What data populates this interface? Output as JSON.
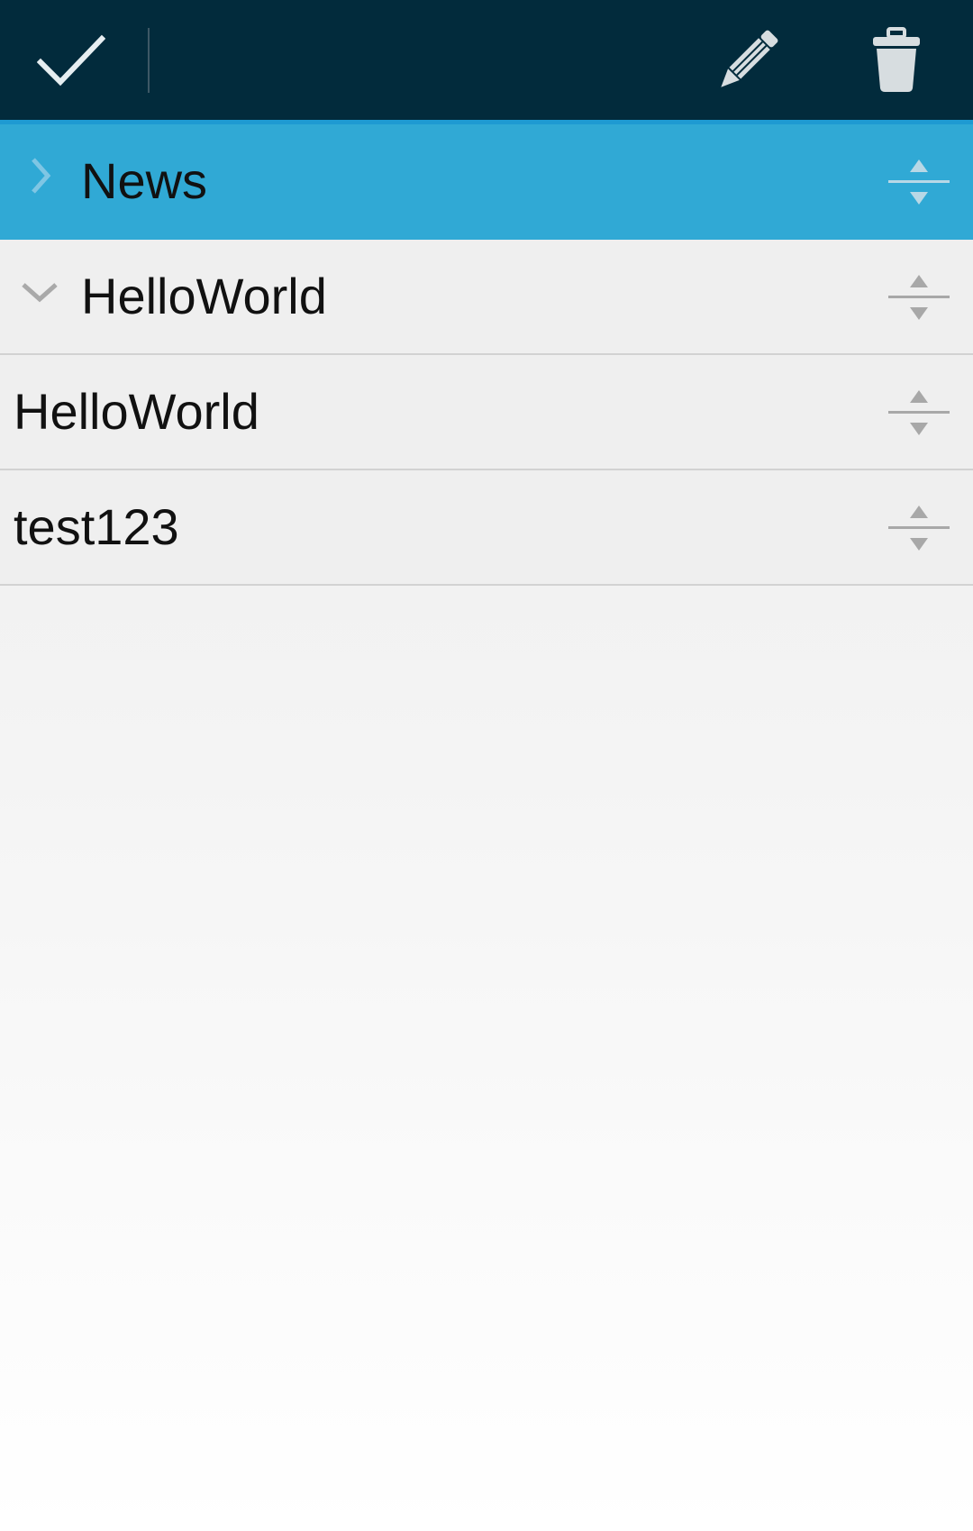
{
  "action_bar": {
    "background": "#022b3c",
    "done_icon": "checkmark-icon",
    "edit_icon": "pencil-icon",
    "delete_icon": "trash-icon"
  },
  "colors": {
    "accent": "#1e9ad2",
    "selected_row": "#30a9d5",
    "row_background": "#efefef"
  },
  "list": {
    "items": [
      {
        "label": "News",
        "expander": "chevron-right-icon",
        "selected": true
      },
      {
        "label": "HelloWorld",
        "expander": "chevron-down-icon",
        "selected": false
      },
      {
        "label": "HelloWorld",
        "expander": null,
        "selected": false
      },
      {
        "label": "test123",
        "expander": null,
        "selected": false
      }
    ],
    "drag_handle_icon": "drag-handle-icon"
  }
}
